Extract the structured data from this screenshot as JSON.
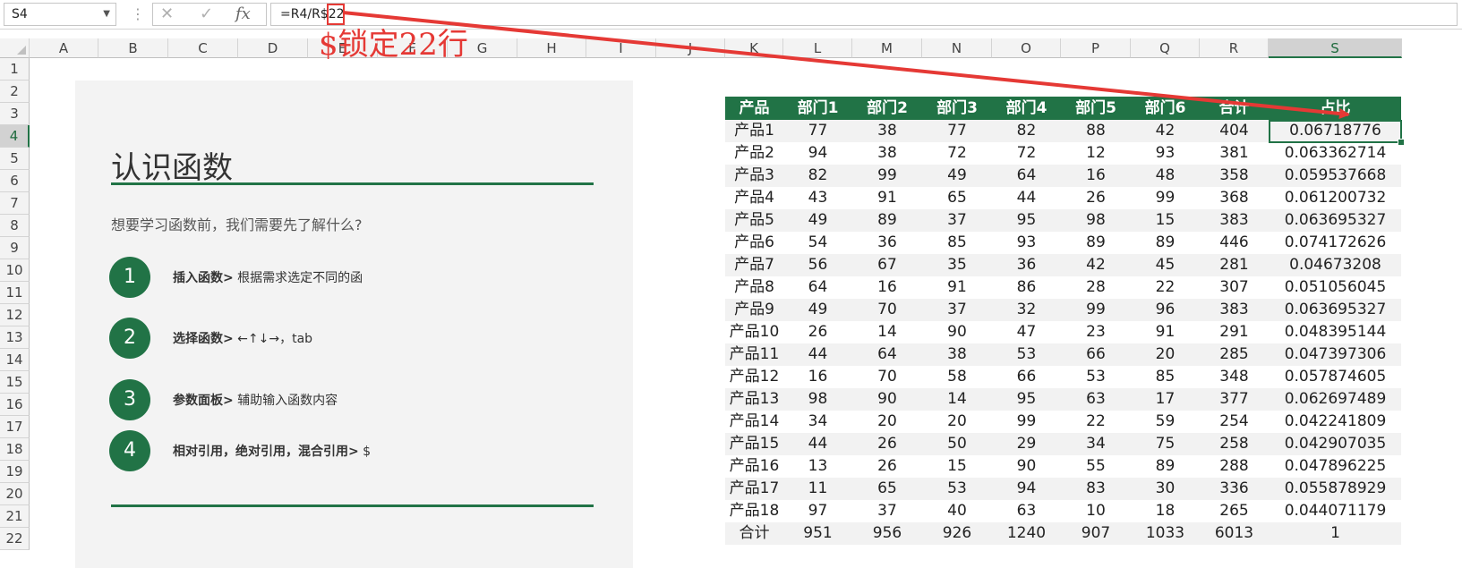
{
  "formula_bar": {
    "name_box": "S4",
    "cancel_icon": "✕",
    "enter_icon": "✓",
    "fx_label": "fx",
    "formula": "=R4/R$22"
  },
  "columns": [
    "A",
    "B",
    "C",
    "D",
    "E",
    "F",
    "G",
    "H",
    "I",
    "J",
    "K",
    "L",
    "M",
    "N",
    "O",
    "P",
    "Q",
    "R",
    "S"
  ],
  "rows": [
    "1",
    "2",
    "3",
    "4",
    "5",
    "6",
    "7",
    "8",
    "9",
    "10",
    "11",
    "12",
    "13",
    "14",
    "15",
    "16",
    "17",
    "18",
    "19",
    "20",
    "21",
    "22"
  ],
  "selected_cell": {
    "col": "S",
    "row": "4"
  },
  "annotation": "$锁定22行",
  "slide": {
    "title": "认识函数",
    "subtitle": "想要学习函数前，我们需要先了解什么?",
    "steps": [
      {
        "num": "1",
        "bold": "插入函数>",
        "text": " 根据需求选定不同的函"
      },
      {
        "num": "2",
        "bold": "选择函数>",
        "text": " ←↑↓→，tab"
      },
      {
        "num": "3",
        "bold": "参数面板>",
        "text": " 辅助输入函数内容"
      },
      {
        "num": "4",
        "bold": "相对引用，绝对引用，混合引用>",
        "text": " $"
      }
    ]
  },
  "table": {
    "headers": [
      "产品",
      "部门1",
      "部门2",
      "部门3",
      "部门4",
      "部门5",
      "部门6",
      "合计",
      "占比"
    ],
    "rows": [
      [
        "产品1",
        "77",
        "38",
        "77",
        "82",
        "88",
        "42",
        "404",
        "0.06718776"
      ],
      [
        "产品2",
        "94",
        "38",
        "72",
        "72",
        "12",
        "93",
        "381",
        "0.063362714"
      ],
      [
        "产品3",
        "82",
        "99",
        "49",
        "64",
        "16",
        "48",
        "358",
        "0.059537668"
      ],
      [
        "产品4",
        "43",
        "91",
        "65",
        "44",
        "26",
        "99",
        "368",
        "0.061200732"
      ],
      [
        "产品5",
        "49",
        "89",
        "37",
        "95",
        "98",
        "15",
        "383",
        "0.063695327"
      ],
      [
        "产品6",
        "54",
        "36",
        "85",
        "93",
        "89",
        "89",
        "446",
        "0.074172626"
      ],
      [
        "产品7",
        "56",
        "67",
        "35",
        "36",
        "42",
        "45",
        "281",
        "0.04673208"
      ],
      [
        "产品8",
        "64",
        "16",
        "91",
        "86",
        "28",
        "22",
        "307",
        "0.051056045"
      ],
      [
        "产品9",
        "49",
        "70",
        "37",
        "32",
        "99",
        "96",
        "383",
        "0.063695327"
      ],
      [
        "产品10",
        "26",
        "14",
        "90",
        "47",
        "23",
        "91",
        "291",
        "0.048395144"
      ],
      [
        "产品11",
        "44",
        "64",
        "38",
        "53",
        "66",
        "20",
        "285",
        "0.047397306"
      ],
      [
        "产品12",
        "16",
        "70",
        "58",
        "66",
        "53",
        "85",
        "348",
        "0.057874605"
      ],
      [
        "产品13",
        "98",
        "90",
        "14",
        "95",
        "63",
        "17",
        "377",
        "0.062697489"
      ],
      [
        "产品14",
        "34",
        "20",
        "20",
        "99",
        "22",
        "59",
        "254",
        "0.042241809"
      ],
      [
        "产品15",
        "44",
        "26",
        "50",
        "29",
        "34",
        "75",
        "258",
        "0.042907035"
      ],
      [
        "产品16",
        "13",
        "26",
        "15",
        "90",
        "55",
        "89",
        "288",
        "0.047896225"
      ],
      [
        "产品17",
        "11",
        "65",
        "53",
        "94",
        "83",
        "30",
        "336",
        "0.055878929"
      ],
      [
        "产品18",
        "97",
        "37",
        "40",
        "63",
        "10",
        "18",
        "265",
        "0.044071179"
      ],
      [
        "合计",
        "951",
        "956",
        "926",
        "1240",
        "907",
        "1033",
        "6013",
        "1"
      ]
    ]
  }
}
